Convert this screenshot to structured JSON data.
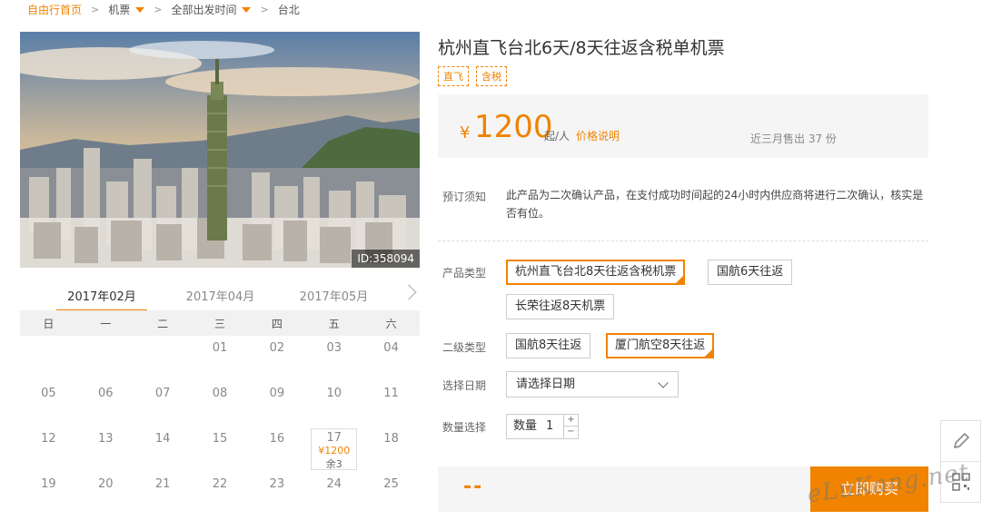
{
  "breadcrumb": {
    "home": "自由行首页",
    "cat": "机票",
    "departure": "全部出发时间",
    "dest": "台北"
  },
  "hero": {
    "id_label": "ID:358094"
  },
  "calendar": {
    "months": [
      "2017年02月",
      "2017年04月",
      "2017年05月"
    ],
    "weekdays": [
      "日",
      "一",
      "二",
      "三",
      "四",
      "五",
      "六"
    ],
    "rows": [
      [
        "",
        "",
        "",
        "01",
        "02",
        "03",
        "04"
      ],
      [
        "05",
        "06",
        "07",
        "08",
        "09",
        "10",
        "11"
      ],
      [
        "12",
        "13",
        "14",
        "15",
        "16",
        "17",
        "18"
      ],
      [
        "19",
        "20",
        "21",
        "22",
        "23",
        "24",
        "25"
      ]
    ],
    "special": {
      "day": "17",
      "price": "¥1200",
      "left": "余3"
    }
  },
  "product": {
    "title": "杭州直飞台北6天/8天往返含税单机票",
    "tags": [
      "直飞",
      "含税"
    ],
    "currency": "¥",
    "price": "1200",
    "price_unit": "起/人",
    "price_link": "价格说明",
    "sold": "近三月售出 37 份"
  },
  "booking": {
    "notice_label": "预订须知",
    "notice_text": "此产品为二次确认产品，在支付成功时间起的24小时内供应商将进行二次确认，核实是否有位。",
    "type_label": "产品类型",
    "types": [
      "杭州直飞台北8天往返含税机票",
      "国航6天往返",
      "长荣往返8天机票"
    ],
    "sub_label": "二级类型",
    "subs": [
      "国航8天往返",
      "厦门航空8天往返"
    ],
    "date_label": "选择日期",
    "date_placeholder": "请选择日期",
    "qty_label": "数量选择",
    "qty_text": "数量",
    "qty_value": "1",
    "qty_plus": "+",
    "qty_minus": "−",
    "total": "--",
    "buy": "立即购买"
  },
  "watermark": "eLuKang.net",
  "colors": {
    "accent": "#f08300",
    "panel": "#f5f5f5"
  },
  "icons": {
    "edit": "pencil-icon",
    "qr": "qr-code-icon"
  }
}
